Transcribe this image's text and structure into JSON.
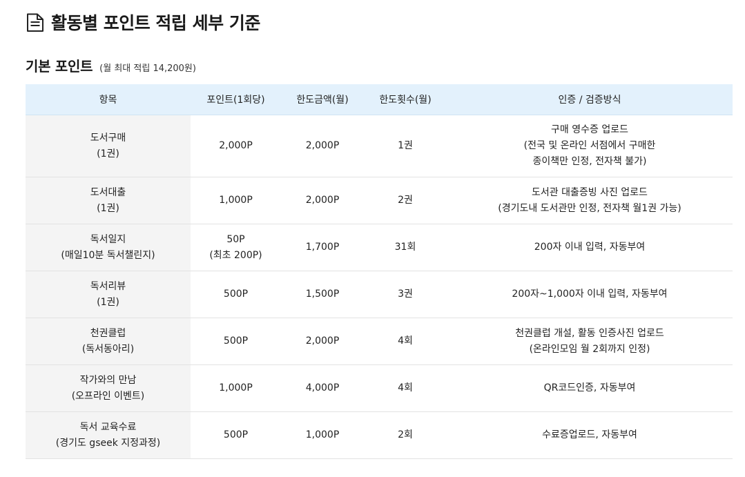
{
  "page_title": "활동별 포인트 적립 세부 기준",
  "icons": {
    "title_icon": "document-icon"
  },
  "section": {
    "title": "기본 포인트",
    "note": "(월 최대 적립 14,200원)"
  },
  "table": {
    "headers": [
      "항목",
      "포인트(1회당)",
      "한도금액(월)",
      "한도횟수(월)",
      "인증 / 검증방식"
    ],
    "rows": [
      {
        "item": [
          "도서구매",
          "(1권)"
        ],
        "points": [
          "2,000P"
        ],
        "limit_amount": "2,000P",
        "limit_count": "1권",
        "method": [
          "구매 영수증 업로드",
          "(전국 및 온라인 서점에서 구매한",
          "종이책만 인정, 전자책 불가)"
        ]
      },
      {
        "item": [
          "도서대출",
          "(1권)"
        ],
        "points": [
          "1,000P"
        ],
        "limit_amount": "2,000P",
        "limit_count": "2권",
        "method": [
          "도서관 대출증빙 사진 업로드",
          "(경기도내 도서관만 인정, 전자책 월1권 가능)"
        ]
      },
      {
        "item": [
          "독서일지",
          "(매일10분 독서챌린지)"
        ],
        "points": [
          "50P",
          "(최초 200P)"
        ],
        "limit_amount": "1,700P",
        "limit_count": "31회",
        "method": [
          "200자 이내 입력, 자동부여"
        ]
      },
      {
        "item": [
          "독서리뷰",
          "(1권)"
        ],
        "points": [
          "500P"
        ],
        "limit_amount": "1,500P",
        "limit_count": "3권",
        "method": [
          "200자~1,000자 이내 입력, 자동부여"
        ]
      },
      {
        "item": [
          "천권클럽",
          "(독서동아리)"
        ],
        "points": [
          "500P"
        ],
        "limit_amount": "2,000P",
        "limit_count": "4회",
        "method": [
          "천권클럽 개설, 활동 인증사진 업로드",
          "(온라인모임 월 2회까지 인정)"
        ]
      },
      {
        "item": [
          "작가와의 만남",
          "(오프라인 이벤트)"
        ],
        "points": [
          "1,000P"
        ],
        "limit_amount": "4,000P",
        "limit_count": "4회",
        "method": [
          "QR코드인증, 자동부여"
        ]
      },
      {
        "item": [
          "독서 교육수료",
          "(경기도 gseek 지정과정)"
        ],
        "points": [
          "500P"
        ],
        "limit_amount": "1,000P",
        "limit_count": "2회",
        "method": [
          "수료증업로드, 자동부여"
        ]
      }
    ]
  },
  "colors": {
    "header_bg": "#e3f1fc",
    "item_cell_bg": "#f4f4f4",
    "divider": "#e2e2e2"
  }
}
